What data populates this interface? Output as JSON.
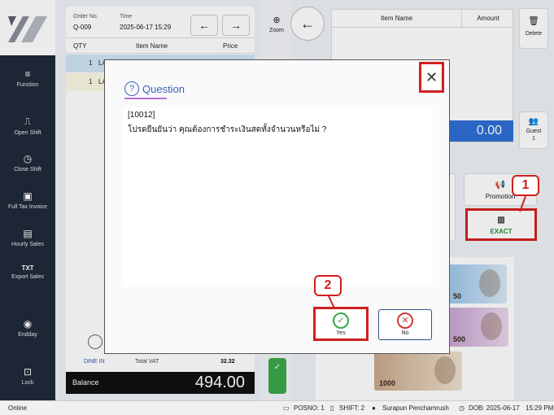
{
  "sidebar": {
    "items": [
      {
        "label": "Function",
        "icon": "menu-icon"
      },
      {
        "label": "Open Shift",
        "icon": "open-shift-icon"
      },
      {
        "label": "Close Shift",
        "icon": "close-shift-icon"
      },
      {
        "label": "Full Tax Invoice",
        "icon": "invoice-icon"
      },
      {
        "label": "Hourly Sales",
        "icon": "document-icon"
      },
      {
        "label": "Export Sales",
        "icon": "txt-icon"
      },
      {
        "label": "Endday",
        "icon": "location-icon"
      },
      {
        "label": "Lock",
        "icon": "lock-icon"
      }
    ]
  },
  "order": {
    "order_no_label": "Order No.",
    "order_no": "Q-009",
    "time_label": "Time",
    "time": "2025-06-17  15:29",
    "columns": {
      "qty": "QTY",
      "item": "Item Name",
      "price": "Price"
    },
    "rows": [
      {
        "qty": "1",
        "item": "LA"
      },
      {
        "qty": "1",
        "item": "LA"
      }
    ],
    "dine_in": "DINE IN",
    "total_vat_label": "Total VAT",
    "total_vat": "32.32",
    "balance_label": "Balance",
    "balance": "494.00"
  },
  "mid": {
    "zoom_label": "Zoom"
  },
  "item_table": {
    "item_header": "Item Name",
    "amount_header": "Amount",
    "amount": "0.00"
  },
  "actions": {
    "delete_label": "Delete",
    "guest_label": "Guest",
    "guest_count": "1",
    "promotion_label": "Promotion",
    "exact_label": "EXACT"
  },
  "notes": [
    {
      "value": "50"
    },
    {
      "value": "500"
    },
    {
      "value": "1000"
    }
  ],
  "dialog": {
    "title": "Question",
    "code": "[10012]",
    "message": "โปรดยืนยันว่า คุณต้องการชำระเงินสดทั้งจำนวนหรือไม่ ?",
    "yes_label": "Yes",
    "no_label": "No"
  },
  "callouts": {
    "one": "1",
    "two": "2"
  },
  "statusbar": {
    "status": "Online",
    "posno": "POSNO: 1",
    "shift": "SHIFT: 2",
    "user": "Surapun Penchamrush",
    "dob": "DOB: 2025-06-17",
    "clock": "15:29 PM"
  },
  "colors": {
    "accent": "#3b63b5",
    "sidebar": "#1f2a3a",
    "callout": "#d21f1f",
    "balance_bar": "#111111",
    "amount_bar": "#2f6fd6"
  }
}
